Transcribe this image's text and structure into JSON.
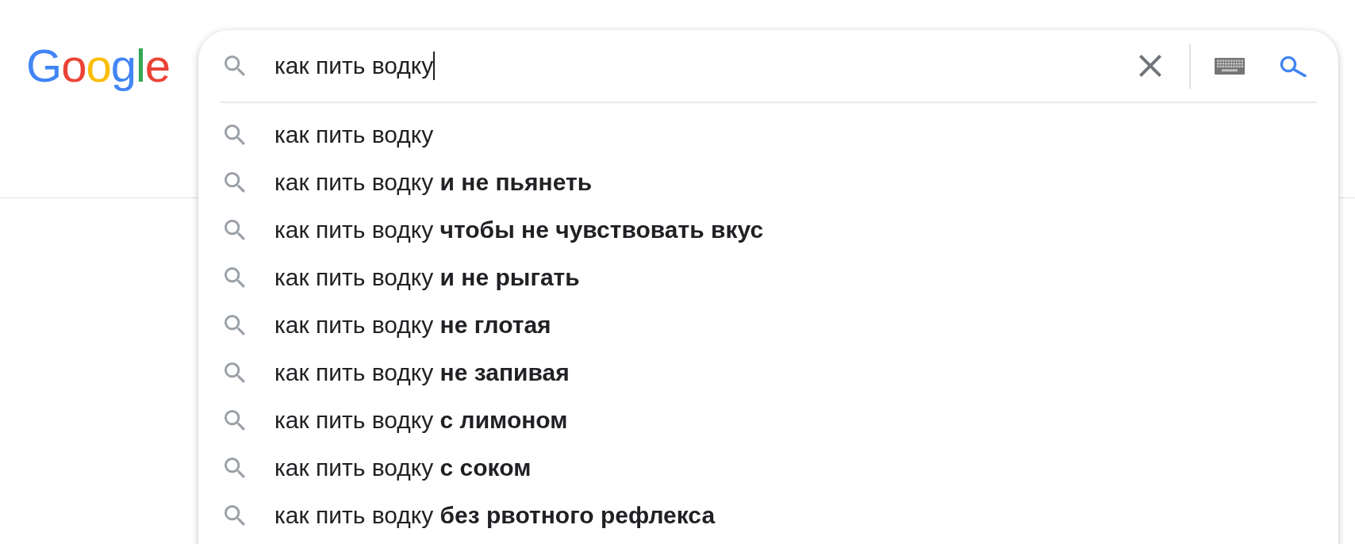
{
  "logo": {
    "text": "Google"
  },
  "search": {
    "value": "как пить водку",
    "focused": true
  },
  "suggestions": [
    "как пить водку",
    "как пить водку **и не пьянеть**",
    "как пить водку **чтобы не чувствовать вкус**",
    "как пить водку **и не рыгать**",
    "как пить водку **не глотая**",
    "как пить водку **не запивая**",
    "как пить водку **с лимоном**",
    "как пить водку **с соком**",
    "как пить водку **без рвотного рефлекса**"
  ]
}
